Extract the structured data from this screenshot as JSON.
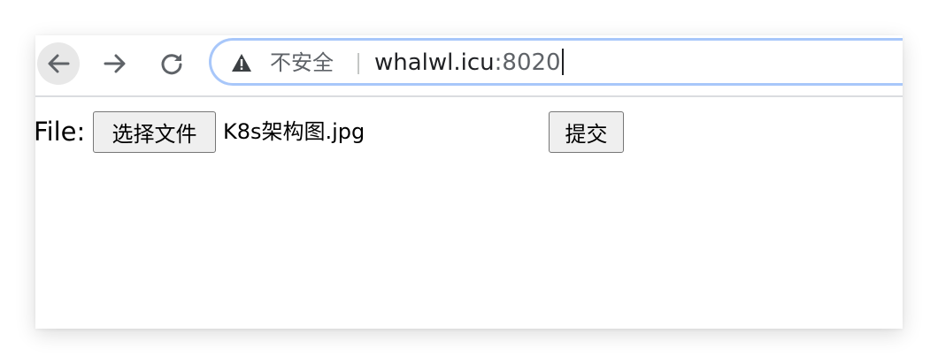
{
  "browser": {
    "security_label": "不安全",
    "url_host": "whalwl.icu",
    "url_port": ":8020",
    "icons": {
      "back": "arrow-left-icon",
      "forward": "arrow-right-icon",
      "reload": "reload-icon",
      "security": "warning-triangle-icon"
    },
    "colors": {
      "omnibox_focus_border": "#a8c7fa",
      "secondary_text": "#5f6368"
    }
  },
  "form": {
    "file_label": "File:",
    "choose_button_label": "选择文件",
    "selected_file_name": "K8s架构图.jpg",
    "submit_button_label": "提交"
  }
}
